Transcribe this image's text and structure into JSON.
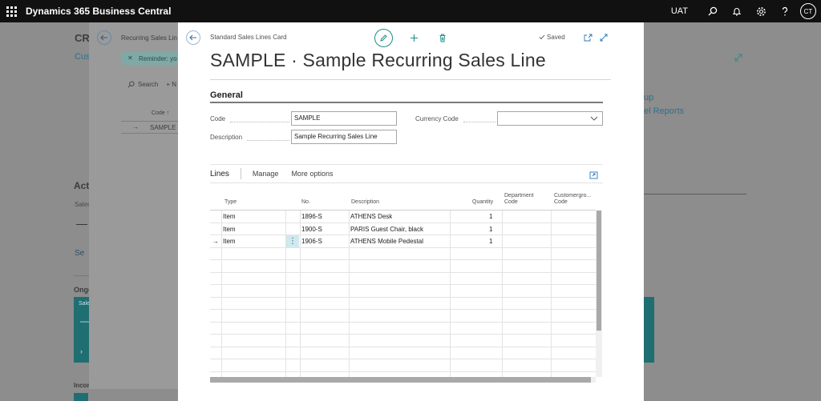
{
  "topbar": {
    "app_title": "Dynamics 365 Business Central",
    "environment": "UAT",
    "avatar_initials": "CT",
    "icons": [
      "search-icon",
      "bell-icon",
      "gear-icon",
      "help-icon"
    ]
  },
  "background": {
    "page_code": "CR",
    "cust_link": "Cust",
    "activities": "Acti",
    "sales": "Sales",
    "dash": "—",
    "see_more": "Se",
    "ongoing": "Ongo",
    "sales_tile": "Sale",
    "tile_dash": "—",
    "income": "Incor",
    "right_link1": "up",
    "right_link2": "el Reports"
  },
  "middle_page": {
    "breadcrumb": "Recurring Sales Lin",
    "reminder": "Reminder: yo",
    "search_label": "Search",
    "code_header": "Code ↑",
    "row_code": "SAMPLE"
  },
  "dialog": {
    "breadcrumb": "Standard Sales Lines Card",
    "saved_label": "Saved",
    "title": "SAMPLE · Sample Recurring Sales Line",
    "general_section": "General",
    "fields": {
      "code_label": "Code",
      "code_value": "SAMPLE",
      "description_label": "Description",
      "description_value": "Sample Recurring Sales Line",
      "currency_label": "Currency Code",
      "currency_value": ""
    },
    "lines": {
      "title": "Lines",
      "actions": [
        "Manage",
        "More options"
      ],
      "columns": {
        "type": "Type",
        "no": "No.",
        "description": "Description",
        "quantity": "Quantity",
        "dept_code_1": "Department",
        "dept_code_2": "Code",
        "cust_code_1": "Customergro...",
        "cust_code_2": "Code"
      },
      "rows": [
        {
          "type": "Item",
          "no": "1896-S",
          "description": "ATHENS Desk",
          "quantity": "1"
        },
        {
          "type": "Item",
          "no": "1900-S",
          "description": "PARIS Guest Chair, black",
          "quantity": "1"
        },
        {
          "type": "Item",
          "no": "1906-S",
          "description": "ATHENS Mobile Pedestal",
          "quantity": "1"
        }
      ],
      "current_row_marker": "→"
    }
  },
  "colors": {
    "topbar": "#111111",
    "accent": "#1f8c8c",
    "teal_tile": "#1f6e71"
  }
}
